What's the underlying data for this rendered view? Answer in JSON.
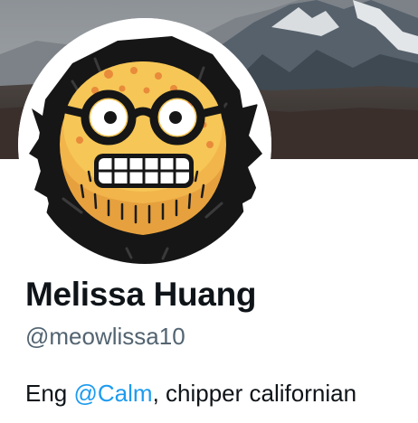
{
  "profile": {
    "display_name": "Melissa Huang",
    "handle": "@meowlissa10",
    "bio": {
      "prefix": "Eng ",
      "mention": "@Calm",
      "suffix": ", chipper californian"
    },
    "banner_image": "mountain-landscape",
    "avatar_image": "bearded-glasses-emoji"
  },
  "colors": {
    "name": "#0f1419",
    "handle": "#536471",
    "link": "#1d9bf0"
  }
}
